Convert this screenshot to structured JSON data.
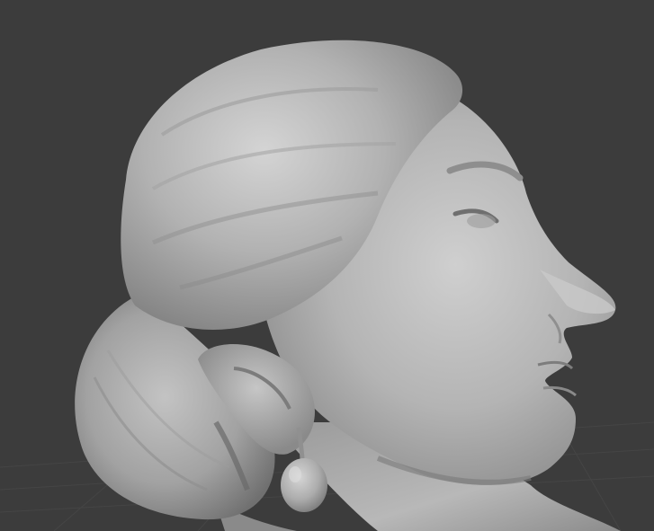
{
  "viewport": {
    "background": "#3c3c3c",
    "grid_color": "#464646",
    "shading": "matcap-gray",
    "subject": "sculpted-female-head-bust",
    "visible_text": []
  },
  "palette": {
    "clay_light": "#d2d2d2",
    "clay_mid": "#a6a6a6",
    "clay_dark": "#6e6e6e",
    "shadow": "#4a4a4a"
  }
}
